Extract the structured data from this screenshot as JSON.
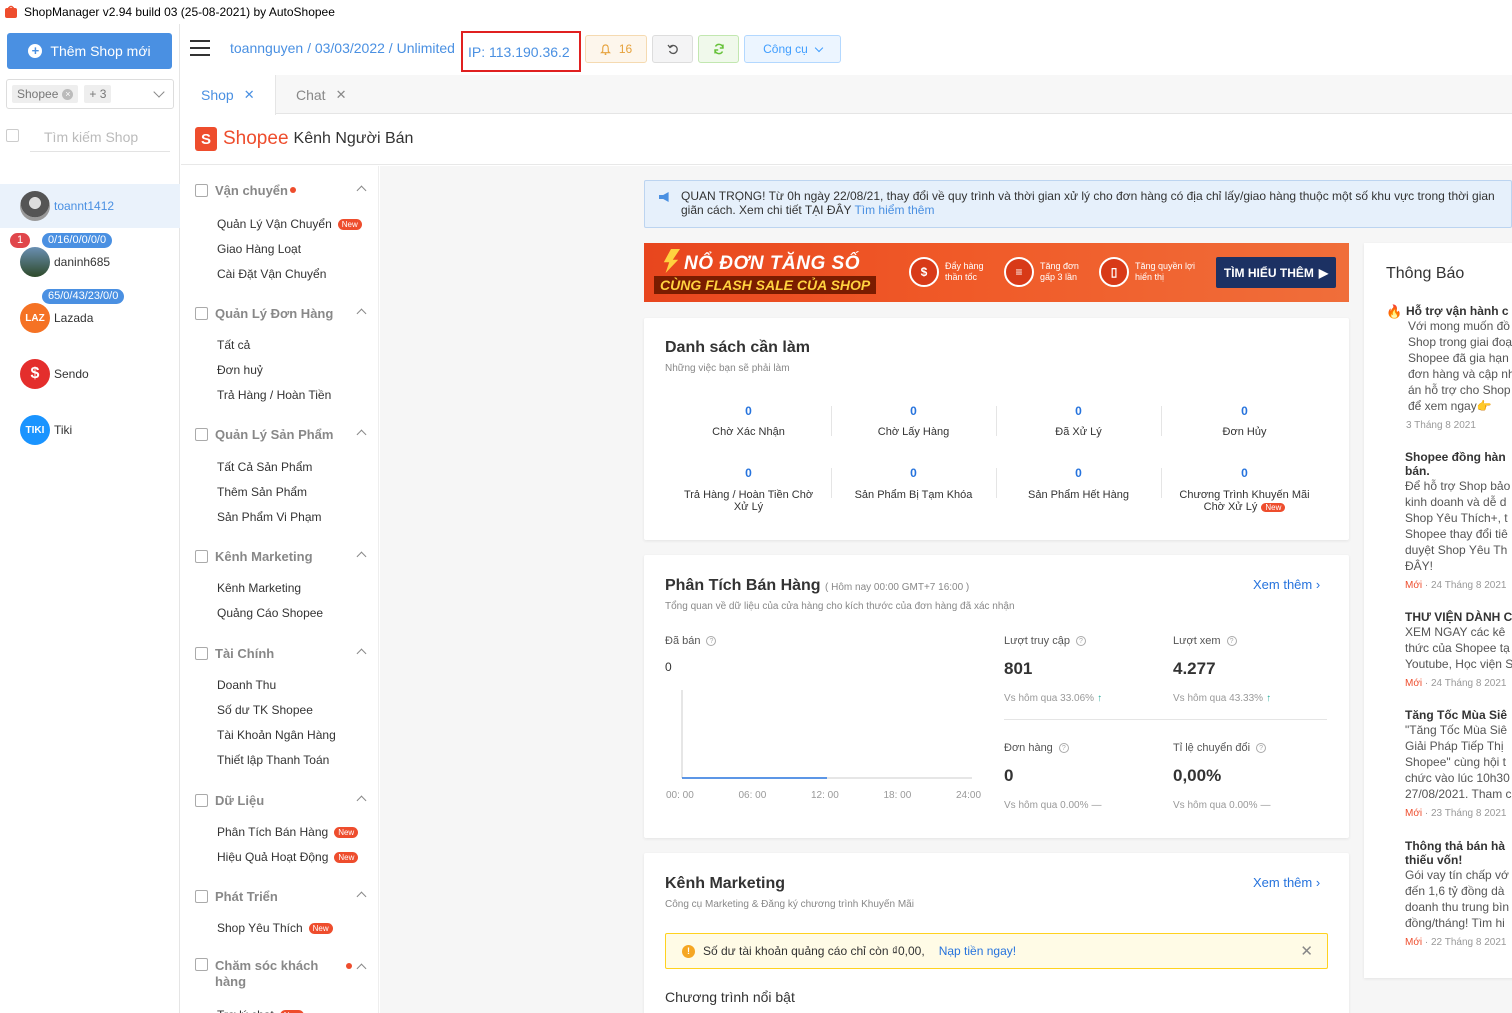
{
  "app": {
    "title": "ShopManager v2.94 build 03 (25-08-2021) by AutoShopee"
  },
  "left_panel": {
    "add_shop_label": "Thêm Shop mới",
    "platform_chip": "Shopee",
    "platform_more": "+ 3",
    "search_placeholder": "Tìm kiếm Shop",
    "accounts": [
      {
        "name": "toannt1412",
        "active": true
      },
      {
        "name": "daninh685",
        "badge_count": "1",
        "stats": "0/16/0/0/0/0"
      },
      {
        "name": "Lazada",
        "stats": "65/0/43/23/0/0",
        "icon": "LAZ"
      },
      {
        "name": "Sendo"
      },
      {
        "name": "Tiki",
        "icon": "TIKI"
      }
    ]
  },
  "toolbar": {
    "breadcrumb": "toannguyen / 03/03/2022 / Unlimited",
    "ip": "IP: 113.190.36.2",
    "bell_count": "16",
    "tools_label": "Công cụ"
  },
  "tabs": [
    {
      "label": "Shop",
      "active": true
    },
    {
      "label": "Chat",
      "active": false
    }
  ],
  "shopee_header": {
    "brand": "Shopee",
    "subtitle": "Kênh Người Bán"
  },
  "seller_nav": [
    {
      "title": "Vận chuyển",
      "dot": true,
      "items": [
        {
          "label": "Quản Lý Vận Chuyển",
          "new": true
        },
        {
          "label": "Giao Hàng Loạt"
        },
        {
          "label": "Cài Đặt Vận Chuyển"
        }
      ]
    },
    {
      "title": "Quản Lý Đơn Hàng",
      "items": [
        {
          "label": "Tất cả"
        },
        {
          "label": "Đơn huỷ"
        },
        {
          "label": "Trả Hàng / Hoàn Tiền"
        }
      ]
    },
    {
      "title": "Quản Lý Sản Phẩm",
      "items": [
        {
          "label": "Tất Cả Sản Phẩm"
        },
        {
          "label": "Thêm Sản Phẩm"
        },
        {
          "label": "Sản Phẩm Vi Phạm"
        }
      ]
    },
    {
      "title": "Kênh Marketing",
      "items": [
        {
          "label": "Kênh Marketing"
        },
        {
          "label": "Quảng Cáo Shopee"
        }
      ]
    },
    {
      "title": "Tài Chính",
      "items": [
        {
          "label": "Doanh Thu"
        },
        {
          "label": "Số dư TK Shopee"
        },
        {
          "label": "Tài Khoản Ngân Hàng"
        },
        {
          "label": "Thiết lập Thanh Toán"
        }
      ]
    },
    {
      "title": "Dữ Liệu",
      "items": [
        {
          "label": "Phân Tích Bán Hàng",
          "new": true
        },
        {
          "label": "Hiệu Quả Hoạt Động",
          "new": true
        }
      ]
    },
    {
      "title": "Phát Triển",
      "items": [
        {
          "label": "Shop Yêu Thích",
          "new": true
        }
      ]
    },
    {
      "title": "Chăm sóc khách hàng",
      "dot": true,
      "items": [
        {
          "label": "Trợ lý chat",
          "new": true
        }
      ]
    }
  ],
  "new_tag": "New",
  "notice": {
    "text": "QUAN TRỌNG! Từ 0h ngày 22/08/21, thay đổi về quy trình và thời gian xử lý cho đơn hàng có địa chỉ lấy/giao hàng thuộc một số khu vực trong thời gian giãn cách. Xem chi tiết TẠI ĐÂY",
    "link": "Tìm hiểm thêm"
  },
  "banner": {
    "line1": "NỔ ĐƠN TĂNG SỐ",
    "line2": "CÙNG FLASH SALE CỦA SHOP",
    "features": [
      "Đẩy hàng thần tốc",
      "Tăng đơn gấp 3 lần",
      "Tăng quyền lợi hiển thị"
    ],
    "cta": "TÌM HIỂU THÊM"
  },
  "todo": {
    "title": "Danh sách cần làm",
    "desc": "Những việc bạn sẽ phải làm",
    "items": [
      {
        "value": "0",
        "label": "Chờ Xác Nhận"
      },
      {
        "value": "0",
        "label": "Chờ Lấy Hàng"
      },
      {
        "value": "0",
        "label": "Đã Xử Lý"
      },
      {
        "value": "0",
        "label": "Đơn Hủy"
      },
      {
        "value": "0",
        "label": "Trả Hàng / Hoàn Tiền Chờ Xử Lý"
      },
      {
        "value": "0",
        "label": "Sản Phẩm Bị Tạm Khóa"
      },
      {
        "value": "0",
        "label": "Sản Phẩm Hết Hàng"
      },
      {
        "value": "0",
        "label": "Chương Trình Khuyến Mãi Chờ Xử Lý",
        "new": true
      }
    ]
  },
  "sales": {
    "title": "Phân Tích Bán Hàng",
    "time_note": "( Hôm nay 00:00 GMT+7 16:00 )",
    "desc": "Tổng quan về dữ liệu của cửa hàng cho kích thước của đơn hàng đã xác nhận",
    "more": "Xem thêm",
    "sold_label": "Đã bán",
    "sold_value": "0",
    "metrics": [
      {
        "title": "Lượt truy cập",
        "value": "801",
        "compare": "Vs hôm qua 33.06%",
        "trend": "up"
      },
      {
        "title": "Lượt xem",
        "value": "4.277",
        "compare": "Vs hôm qua 43.33%",
        "trend": "up"
      },
      {
        "title": "Đơn hàng",
        "value": "0",
        "compare": "Vs hôm qua 0.00%",
        "trend": "flat"
      },
      {
        "title": "Tỉ lệ chuyển đổi",
        "value": "0,00%",
        "compare": "Vs hôm qua 0.00%",
        "trend": "flat"
      }
    ],
    "chart_x_ticks": [
      "00: 00",
      "06: 00",
      "12: 00",
      "18: 00",
      "24:00"
    ]
  },
  "chart_data": {
    "type": "line",
    "x": [
      "00: 00",
      "06: 00",
      "12: 00",
      "18: 00",
      "24:00"
    ],
    "series": [
      {
        "values": [
          0,
          0,
          0,
          null,
          null
        ]
      }
    ],
    "xlabel": "",
    "ylabel": "",
    "xlim_labels": [
      "00: 00",
      "24:00"
    ],
    "grid": false
  },
  "marketing": {
    "title": "Kênh Marketing",
    "desc": "Công cụ Marketing & Đăng ký chương trình Khuyến Mãi",
    "more": "Xem thêm",
    "warning": "Số dư tài khoản quảng cáo chỉ còn ₫0,00,",
    "warning_link": "Nạp tiền ngay!",
    "featured": "Chương trình nổi bật"
  },
  "notifications": {
    "title": "Thông Báo",
    "items": [
      {
        "title": "Hỗ trợ vận hành c",
        "body": [
          "Với mong muốn đồ",
          "Shop trong giai đoạ",
          "Shopee đã gia hạn",
          "đơn hàng và cập nh",
          "án hỗ trợ cho Shop",
          "để xem ngay👉"
        ],
        "date": "3 Tháng 8 2021"
      },
      {
        "title": "Shopee đồng hàn bán.",
        "body": [
          "Để hỗ trợ Shop bảo",
          "kinh doanh và dễ d",
          "Shop Yêu Thích+, t",
          "Shopee thay đổi tiê",
          "duyệt Shop Yêu Th",
          "ĐÂY!"
        ],
        "new": "Mới",
        "date": "24 Tháng 8 2021"
      },
      {
        "title": "THƯ VIỆN DÀNH C",
        "body": [
          "XEM NGAY các kê",
          "thức của Shopee tạ",
          "Youtube, Học viện S"
        ],
        "new": "Mới",
        "date": "24 Tháng 8 2021"
      },
      {
        "title": "Tăng Tốc Mùa Siê",
        "body": [
          "\"Tăng Tốc Mùa Siê",
          "Giải Pháp Tiếp Thị",
          "Shopee\" cùng hội t",
          "chức vào lúc 10h30",
          "27/08/2021. Tham c"
        ],
        "new": "Mới",
        "date": "23 Tháng 8 2021"
      },
      {
        "title": "Thông thả bán hà thiếu vốn!",
        "body": [
          "Gói vay tín chấp vớ",
          "đến 1,6 tỷ đồng dà",
          "doanh thu trung bìn",
          "đồng/tháng! Tìm hi"
        ],
        "new": "Mới",
        "date": "22 Tháng 8 2021"
      }
    ]
  },
  "colors": {
    "accent": "#4a90e2",
    "shopee": "#ee4d2d",
    "link": "#2673dd"
  }
}
